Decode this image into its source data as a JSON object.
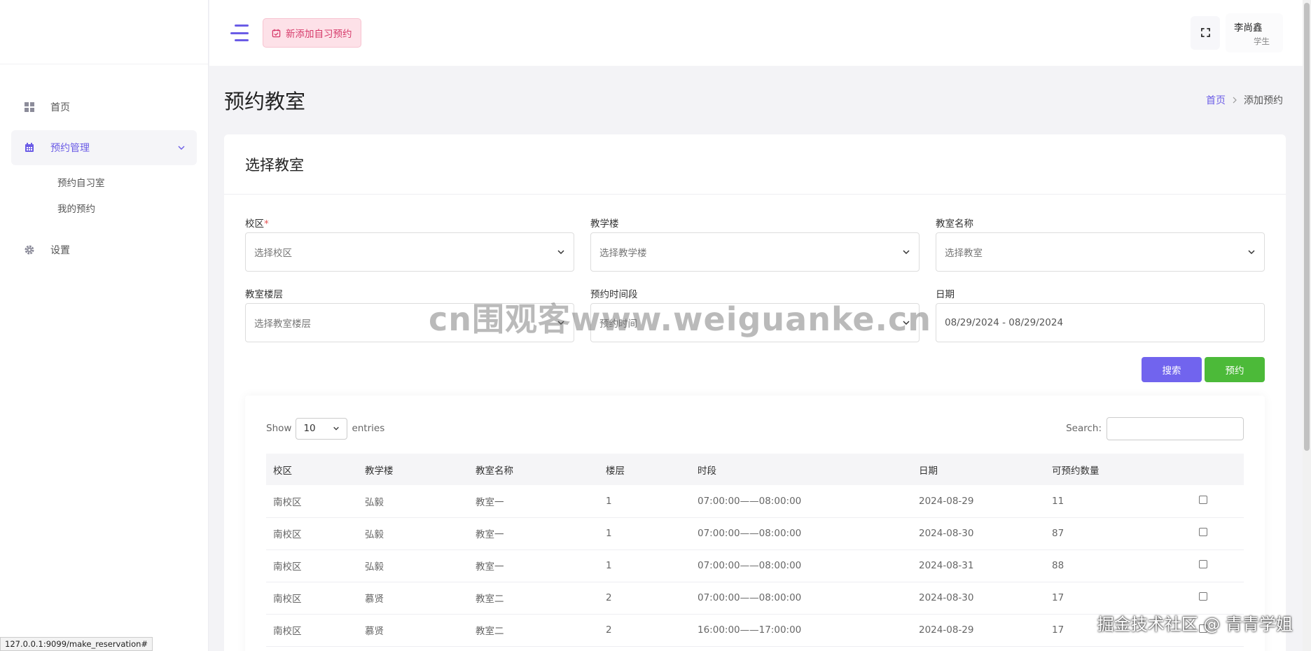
{
  "sidebar": {
    "items": [
      {
        "label": "首页",
        "icon": "dashboard-icon"
      },
      {
        "label": "预约管理",
        "icon": "calendar-icon"
      },
      {
        "label": "设置",
        "icon": "gear-icon"
      }
    ],
    "subitems": [
      {
        "label": "预约自习室"
      },
      {
        "label": "我的预约"
      }
    ]
  },
  "topbar": {
    "new_reservation": "新添加自习预约",
    "user_name": "李尚鑫",
    "user_role": "学生"
  },
  "page": {
    "title": "预约教室",
    "breadcrumb_home": "首页",
    "breadcrumb_current": "添加预约"
  },
  "card": {
    "title": "选择教室"
  },
  "form": {
    "campus_label": "校区",
    "campus_required": "*",
    "campus_placeholder": "选择校区",
    "building_label": "教学楼",
    "building_placeholder": "选择教学楼",
    "room_label": "教室名称",
    "room_placeholder": "选择教室",
    "floor_label": "教室楼层",
    "floor_placeholder": "选择教室楼层",
    "period_label": "预约时间段",
    "period_placeholder": "预约时间",
    "date_label": "日期",
    "date_value": "08/29/2024 - 08/29/2024",
    "search_button": "搜索",
    "reserve_button": "预约"
  },
  "table": {
    "show": "Show",
    "entries_value": "10",
    "entries": "entries",
    "search_label": "Search:",
    "headers": [
      "校区",
      "教学楼",
      "教室名称",
      "楼层",
      "时段",
      "日期",
      "可预约数量",
      ""
    ],
    "rows": [
      [
        "南校区",
        "弘毅",
        "教室一",
        "1",
        "07:00:00——08:00:00",
        "2024-08-29",
        "11"
      ],
      [
        "南校区",
        "弘毅",
        "教室一",
        "1",
        "07:00:00——08:00:00",
        "2024-08-30",
        "87"
      ],
      [
        "南校区",
        "弘毅",
        "教室一",
        "1",
        "07:00:00——08:00:00",
        "2024-08-31",
        "88"
      ],
      [
        "南校区",
        "慕贤",
        "教室二",
        "2",
        "07:00:00——08:00:00",
        "2024-08-30",
        "17"
      ],
      [
        "南校区",
        "慕贤",
        "教室二",
        "2",
        "16:00:00——17:00:00",
        "2024-08-29",
        "17"
      ]
    ]
  },
  "overlay": {
    "watermark": "cn围观客www.weiguanke.cn",
    "watermark_corner": "掘金技术社区 @ 青青学姐",
    "status_url": "127.0.0.1:9099/make_reservation#"
  },
  "colors": {
    "accent": "#6b5ce6",
    "success": "#4cba39",
    "danger": "#d63a6a"
  }
}
